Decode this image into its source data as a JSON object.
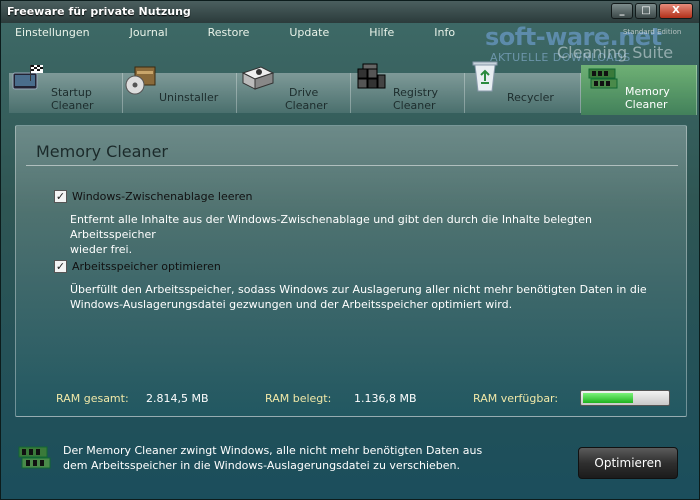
{
  "window": {
    "title": "Freeware für private Nutzung"
  },
  "window_controls": {
    "minimize": "_",
    "maximize": "□",
    "close": "X"
  },
  "menu": [
    "Einstellungen",
    "Journal",
    "Restore",
    "Update",
    "Hilfe",
    "Info"
  ],
  "brand": {
    "main": "soft-ware.net",
    "sub": "AKTUELLE DOWNLOADS",
    "right": "Cleaning Suite",
    "edition": "Standard Edition"
  },
  "tools": [
    {
      "line1": "Startup",
      "line2": "Cleaner",
      "icon": "flag-icon"
    },
    {
      "line1": "Uninstaller",
      "line2": "",
      "icon": "uninstaller-icon"
    },
    {
      "line1": "Drive",
      "line2": "Cleaner",
      "icon": "drive-icon"
    },
    {
      "line1": "Registry",
      "line2": "Cleaner",
      "icon": "registry-icon"
    },
    {
      "line1": "Recycler",
      "line2": "",
      "icon": "recycle-icon"
    },
    {
      "line1": "Memory",
      "line2": "Cleaner",
      "icon": "memory-icon",
      "active": true
    }
  ],
  "panel": {
    "title": "Memory Cleaner",
    "options": [
      {
        "label": "Windows-Zwischenablage leeren",
        "checked": true,
        "desc_line1": "Entfernt alle Inhalte aus der Windows-Zwischenablage und gibt den durch die Inhalte belegten Arbeitsspeicher",
        "desc_line2": "wieder frei."
      },
      {
        "label": "Arbeitsspeicher optimieren",
        "checked": true,
        "desc_line1": "Überfüllt den Arbeitsspeicher, sodass Windows zur Auslagerung aller nicht mehr benötigten Daten in die",
        "desc_line2": "Windows-Auslagerungsdatei gezwungen und der Arbeitsspeicher optimiert wird."
      }
    ],
    "stats": {
      "total_label": "RAM gesamt:",
      "total_value": "2.814,5 MB",
      "used_label": "RAM belegt:",
      "used_value": "1.136,8 MB",
      "free_label": "RAM verfügbar:",
      "free_fraction": 0.6
    }
  },
  "footer": {
    "text_line1": "Der Memory Cleaner zwingt Windows, alle nicht mehr benötigten Daten aus",
    "text_line2": "dem Arbeitsspeicher in die Windows-Auslagerungsdatei zu verschieben.",
    "button": "Optimieren"
  },
  "colors": {
    "active_tab": "#4e9a63",
    "ram_fill": "#1fb31f",
    "stat_label": "#f0e8a8"
  }
}
